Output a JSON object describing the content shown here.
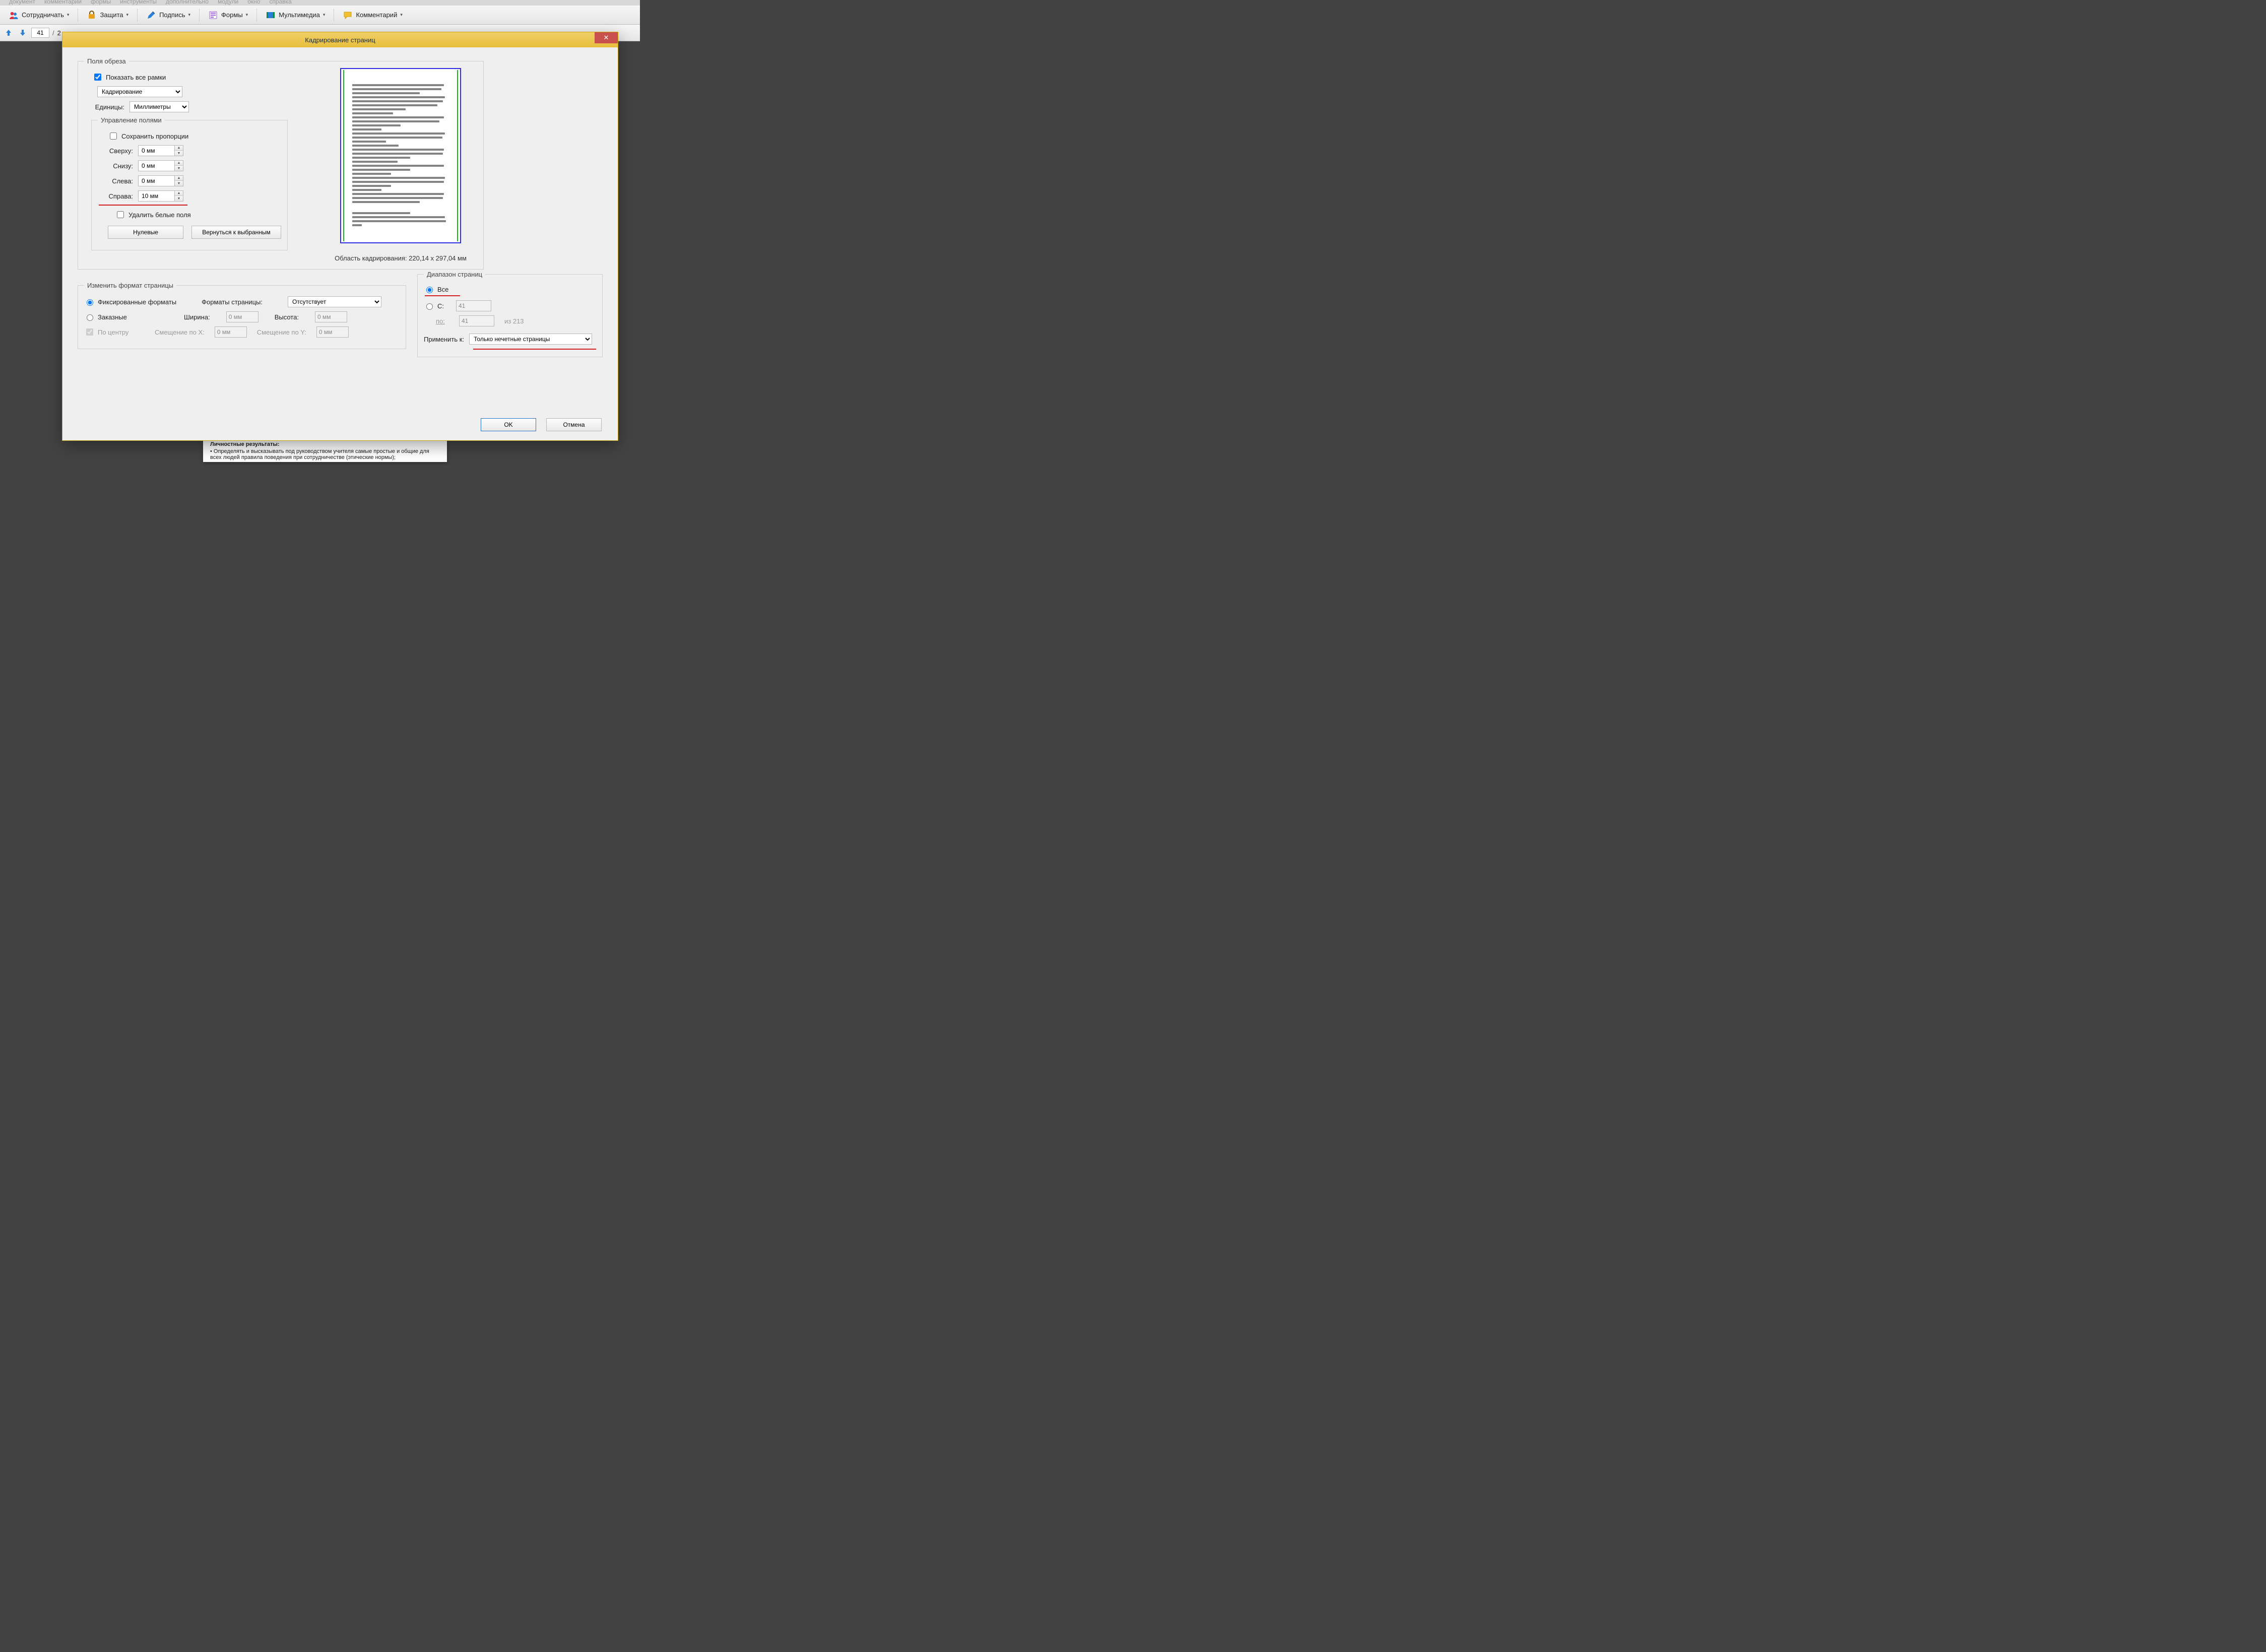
{
  "menu": {
    "items": [
      "документ",
      "комментарии",
      "формы",
      "инструменты",
      "дополнительно",
      "модули",
      "окно",
      "справка"
    ]
  },
  "toolbar": {
    "collab": "Сотрудничать",
    "protect": "Защита",
    "sign": "Подпись",
    "forms": "Формы",
    "media": "Мультимедиа",
    "comment": "Комментарий"
  },
  "nav": {
    "page": "41",
    "sep": "/",
    "total": "2"
  },
  "dialog": {
    "title": "Кадрирование страниц",
    "close": "✕",
    "fields_legend": "Поля обреза",
    "show_all_frames": "Показать все рамки",
    "crop_select": "Кадрирование",
    "units_label": "Единицы:",
    "units_value": "Миллиметры",
    "margins_legend": "Управление полями",
    "keep_ratio": "Сохранить пропорции",
    "top_label": "Сверху:",
    "top_value": "0 мм",
    "bottom_label": "Снизу:",
    "bottom_value": "0 мм",
    "left_label": "Слева:",
    "left_value": "0 мм",
    "right_label": "Справа:",
    "right_value": "10 мм",
    "remove_white": "Удалить белые поля",
    "btn_zero": "Нулевые",
    "btn_revert": "Вернуться к выбранным",
    "crop_area_prefix": "Область кадрирования: ",
    "crop_area_value": "220,14 x 297,04 мм",
    "resize_legend": "Изменить формат страницы",
    "fixed_fmt": "Фиксированные форматы",
    "custom_fmt": "Заказные",
    "page_formats_label": "Форматы страницы:",
    "page_formats_value": "Отсутствует",
    "width_label": "Ширина:",
    "width_value": "0 мм",
    "height_label": "Высота:",
    "height_value": "0 мм",
    "center": "По центру",
    "offx_label": "Смещение по X:",
    "offx_value": "0 мм",
    "offy_label": "Смещение по Y:",
    "offy_value": "0 мм",
    "range_legend": "Диапазон страниц",
    "all": "Все",
    "from_label": "С:",
    "from_value": "41",
    "to_label": "по:",
    "to_value": "41",
    "of_total": "из 213",
    "apply_label": "Применить к:",
    "apply_value": "Только нечетные страницы",
    "ok": "OK",
    "cancel": "Отмена"
  },
  "docstrip": {
    "l1": "Личностные результаты:",
    "l2": "•   Определять и высказывать под руководством учителя самые простые и общие для всех людей правила поведения при сотрудничестве (этические нормы);"
  }
}
